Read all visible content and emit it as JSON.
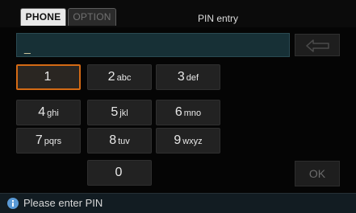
{
  "tabs": {
    "phone": "PHONE",
    "option": "OPTION"
  },
  "header": {
    "title": "PIN entry"
  },
  "input": {
    "value": "_"
  },
  "icons": {
    "backspace": "backspace-arrow-icon",
    "info": "info-icon"
  },
  "keypad": {
    "k1": {
      "digit": "1",
      "letters": ""
    },
    "k2": {
      "digit": "2",
      "letters": "abc"
    },
    "k3": {
      "digit": "3",
      "letters": "def"
    },
    "k4": {
      "digit": "4",
      "letters": "ghi"
    },
    "k5": {
      "digit": "5",
      "letters": "jkl"
    },
    "k6": {
      "digit": "6",
      "letters": "mno"
    },
    "k7": {
      "digit": "7",
      "letters": "pqrs"
    },
    "k8": {
      "digit": "8",
      "letters": "tuv"
    },
    "k9": {
      "digit": "9",
      "letters": "wxyz"
    },
    "k0": {
      "digit": "0",
      "letters": ""
    },
    "ok_label": "OK"
  },
  "status": {
    "message": "Please enter PIN"
  },
  "colors": {
    "selection_border": "#d46a14",
    "input_background": "#173036",
    "status_background": "#121c22",
    "info_icon": "#5a9ad6"
  }
}
